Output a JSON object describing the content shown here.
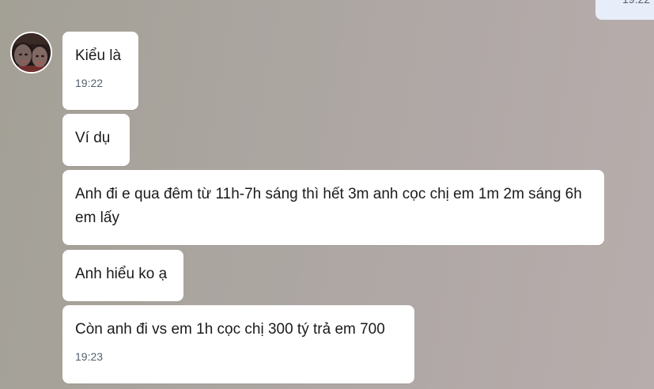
{
  "conversation": {
    "outgoing_partial": {
      "time": "19:22"
    },
    "contact": {
      "avatar_icon": "user-photo-avatar"
    },
    "messages": [
      {
        "text": "Kiểu là",
        "time": "19:22"
      },
      {
        "text": "Ví dụ"
      },
      {
        "text": "Anh đi e qua đêm từ 11h-7h sáng thì hết 3m anh cọc chị em 1m 2m sáng 6h em lấy"
      },
      {
        "text": "Anh hiểu ko ạ"
      },
      {
        "text": "Còn anh đi vs em 1h cọc chị 300 tý trả em 700",
        "time": "19:23"
      }
    ]
  },
  "colors": {
    "bubble_incoming": "#ffffff",
    "bubble_outgoing": "#e7edf9",
    "timestamp": "#55606e"
  }
}
